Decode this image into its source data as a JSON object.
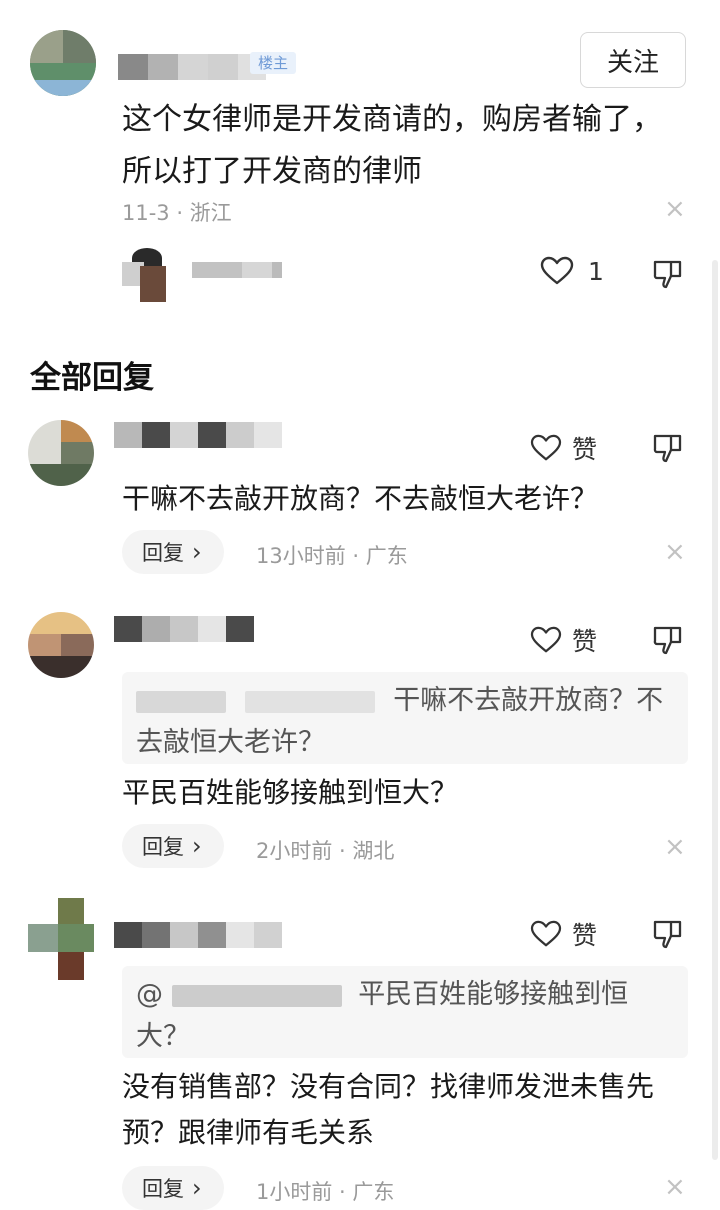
{
  "op": {
    "name_mask": "",
    "badge": "楼主",
    "follow_label": "关注",
    "text": "这个女律师是开发商请的，购房者输了，所以打了开发商的律师",
    "meta": "11-3 · 浙江",
    "like_count": "1"
  },
  "replies_section": {
    "title": "全部回复"
  },
  "replies": [
    {
      "text": "干嘛不去敲开放商？不去敲恒大老许？",
      "like_label": "赞",
      "reply_label": "回复",
      "reply_chevron": "›",
      "meta": "13小时前 · 广东"
    },
    {
      "quote": "干嘛不去敲开放商？不去敲恒大老许？",
      "text": "平民百姓能够接触到恒大？",
      "like_label": "赞",
      "reply_label": "回复",
      "reply_chevron": "›",
      "meta": "2小时前 · 湖北"
    },
    {
      "quote_prefix": "@",
      "quote": "平民百姓能够接触到恒大？",
      "text": "没有销售部？没有合同？找律师发泄未售先预？跟律师有毛关系",
      "like_label": "赞",
      "reply_label": "回复",
      "reply_chevron": "›",
      "meta": "1小时前 · 广东"
    }
  ],
  "icons": {
    "close": "×"
  },
  "colors": {
    "badge_bg": "#e9f1fb",
    "badge_text": "#6f9ad6",
    "meta_gray": "#9a9a9a"
  }
}
